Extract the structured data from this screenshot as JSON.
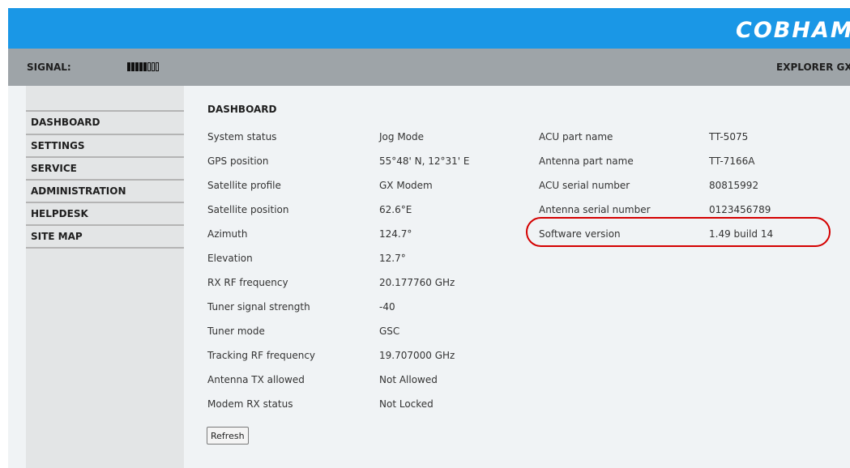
{
  "header": {
    "logo_text": "COBHAM",
    "background_color": "#1a97e6"
  },
  "status_bar": {
    "signal_label": "SIGNAL:",
    "signal_level": 5,
    "signal_max": 8,
    "product_name": "EXPLORER GX"
  },
  "sidebar": {
    "items": [
      {
        "label": "DASHBOARD"
      },
      {
        "label": "SETTINGS"
      },
      {
        "label": "SERVICE"
      },
      {
        "label": "ADMINISTRATION"
      },
      {
        "label": "HELPDESK"
      },
      {
        "label": "SITE MAP"
      }
    ]
  },
  "dashboard": {
    "title": "DASHBOARD",
    "left_rows": [
      {
        "label": "System status",
        "value": "Jog Mode"
      },
      {
        "label": "GPS position",
        "value": "55°48' N, 12°31' E"
      },
      {
        "label": "Satellite profile",
        "value": "GX Modem"
      },
      {
        "label": "Satellite position",
        "value": "62.6°E"
      },
      {
        "label": "Azimuth",
        "value": "124.7°"
      },
      {
        "label": "Elevation",
        "value": "12.7°"
      },
      {
        "label": "RX RF frequency",
        "value": "20.177760 GHz"
      },
      {
        "label": "Tuner signal strength",
        "value": "-40"
      },
      {
        "label": "Tuner mode",
        "value": "GSC"
      },
      {
        "label": "Tracking RF frequency",
        "value": "19.707000 GHz"
      },
      {
        "label": "Antenna TX allowed",
        "value": "Not Allowed"
      },
      {
        "label": "Modem RX status",
        "value": "Not Locked"
      }
    ],
    "right_rows": [
      {
        "label": "ACU part name",
        "value": "TT-5075"
      },
      {
        "label": "Antenna part name",
        "value": "TT-7166A"
      },
      {
        "label": "ACU serial number",
        "value": "80815992"
      },
      {
        "label": "Antenna serial number",
        "value": "0123456789"
      },
      {
        "label": "Software version",
        "value": "1.49 build 14"
      }
    ],
    "refresh_label": "Refresh",
    "highlight_color": "#d40000"
  }
}
